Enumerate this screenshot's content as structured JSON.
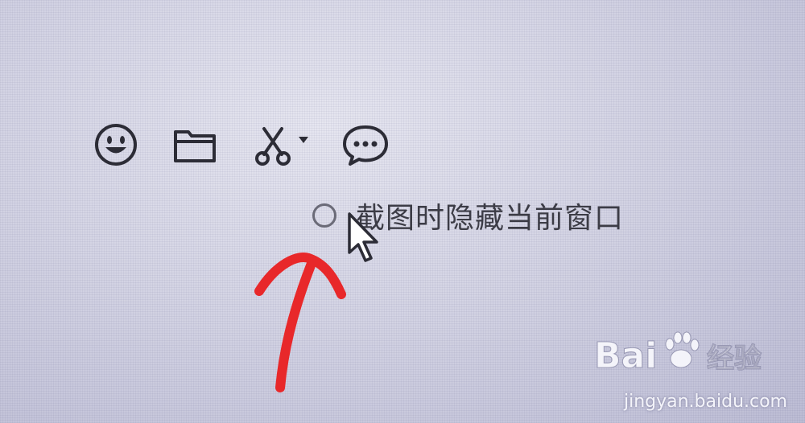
{
  "toolbar": {
    "items": [
      {
        "icon": "emoji-icon",
        "name": "emoji"
      },
      {
        "icon": "folder-icon",
        "name": "send-file"
      },
      {
        "icon": "scissors-icon",
        "name": "screenshot"
      },
      {
        "icon": "chat-bubble-icon",
        "name": "chat-history"
      }
    ]
  },
  "screenshot_option": {
    "label": "截图时隐藏当前窗口",
    "checked": false
  },
  "annotation": {
    "color": "#e8282a"
  },
  "watermark": {
    "logo_text": "Bai  经验",
    "url": "jingyan.baidu.com"
  }
}
